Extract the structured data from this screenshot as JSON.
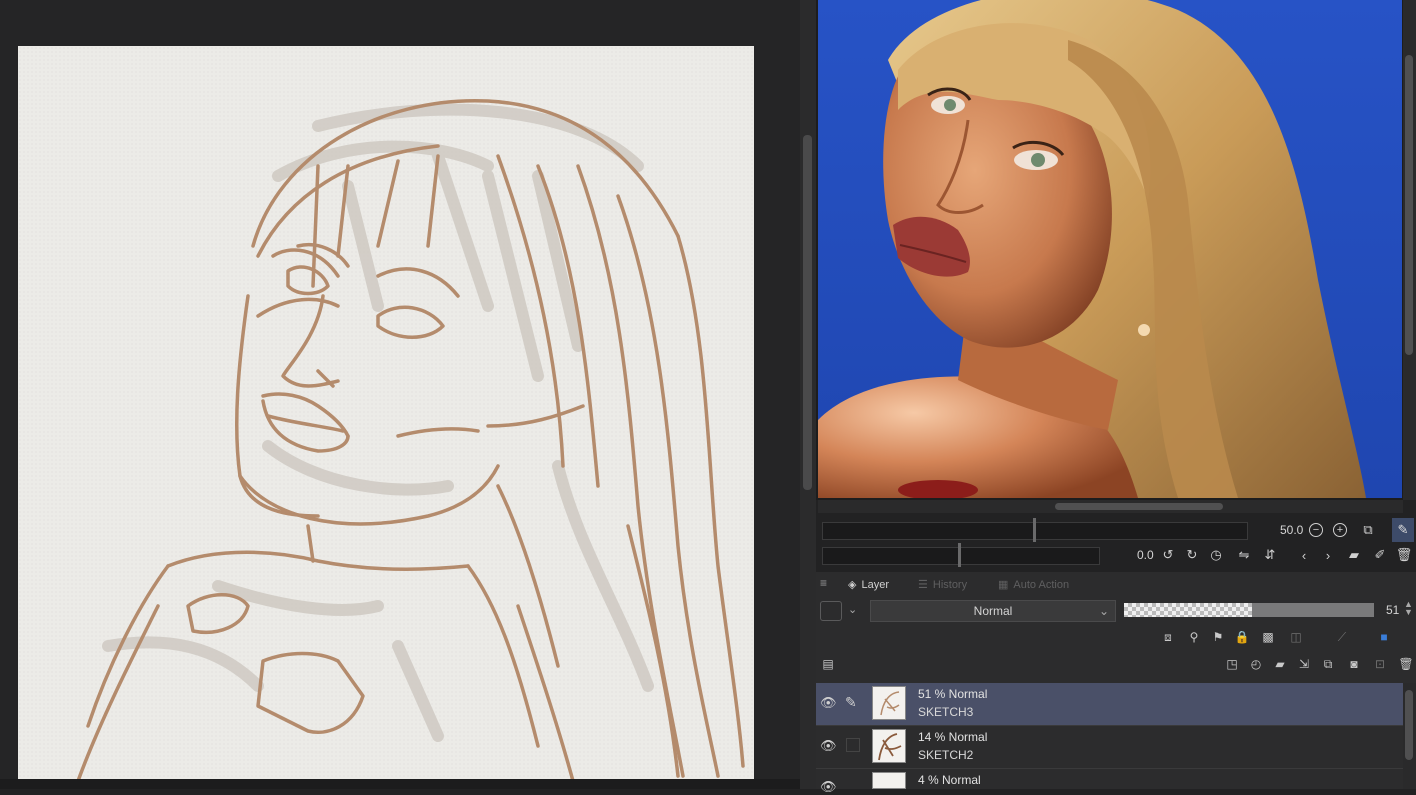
{
  "navigator": {
    "zoom_value": "50.0",
    "rotation_value": "0.0"
  },
  "layer_panel": {
    "tabs": [
      {
        "label": "Layer",
        "icon": "layers-icon",
        "active": true
      },
      {
        "label": "History",
        "icon": "history-icon",
        "active": false
      },
      {
        "label": "Auto Action",
        "icon": "auto-action-icon",
        "active": false
      }
    ],
    "blend_mode": "Normal",
    "opacity_value": "51",
    "opacity_fraction": 0.51,
    "layers": [
      {
        "mode": "51 % Normal",
        "name": "SKETCH3",
        "selected": true,
        "visible": true
      },
      {
        "mode": "14 % Normal",
        "name": "SKETCH2",
        "selected": false,
        "visible": true
      },
      {
        "mode": "4 % Normal",
        "name": "",
        "selected": false,
        "visible": true
      }
    ]
  },
  "colors": {
    "accent_selected_row": "#4a5068",
    "sketch_stroke": "#b48b6c",
    "sketch_light": "#cfc9c2",
    "reference_sky": "#2a56c4"
  }
}
